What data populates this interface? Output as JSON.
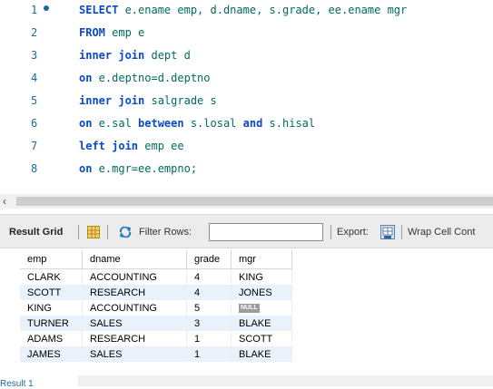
{
  "editor": {
    "lines": [
      {
        "num": "1",
        "marker": true,
        "tokens": [
          {
            "t": "SELECT",
            "k": "kw"
          },
          {
            "t": " e.ename emp, d.dname, s.grade, ee.ename mgr",
            "k": "tx"
          }
        ]
      },
      {
        "num": "2",
        "tokens": [
          {
            "t": "FROM",
            "k": "kw"
          },
          {
            "t": " emp e",
            "k": "tx"
          }
        ]
      },
      {
        "num": "3",
        "tokens": [
          {
            "t": "inner join",
            "k": "kw"
          },
          {
            "t": " dept d",
            "k": "tx"
          }
        ]
      },
      {
        "num": "4",
        "tokens": [
          {
            "t": "on",
            "k": "kw"
          },
          {
            "t": " e.deptno=d.deptno",
            "k": "tx"
          }
        ]
      },
      {
        "num": "5",
        "tokens": [
          {
            "t": "inner join",
            "k": "kw"
          },
          {
            "t": " salgrade s",
            "k": "tx"
          }
        ]
      },
      {
        "num": "6",
        "tokens": [
          {
            "t": "on",
            "k": "kw"
          },
          {
            "t": " e.sal ",
            "k": "tx"
          },
          {
            "t": "between",
            "k": "kw"
          },
          {
            "t": " s.losal ",
            "k": "tx"
          },
          {
            "t": "and",
            "k": "kw"
          },
          {
            "t": " s.hisal",
            "k": "tx"
          }
        ]
      },
      {
        "num": "7",
        "tokens": [
          {
            "t": "left join",
            "k": "kw"
          },
          {
            "t": " emp ee",
            "k": "tx"
          }
        ]
      },
      {
        "num": "8",
        "tokens": [
          {
            "t": "on",
            "k": "kw"
          },
          {
            "t": " e.mgr=ee.empno;",
            "k": "tx"
          }
        ]
      }
    ]
  },
  "scrollbar": {
    "arrow": "‹"
  },
  "toolbar": {
    "result_grid_label": "Result Grid",
    "filter_label": "Filter Rows:",
    "filter_value": "",
    "export_label": "Export:",
    "wrap_label": "Wrap Cell Cont"
  },
  "grid": {
    "columns": [
      "emp",
      "dname",
      "grade",
      "mgr"
    ],
    "rows": [
      [
        "CLARK",
        "ACCOUNTING",
        "4",
        "KING"
      ],
      [
        "SCOTT",
        "RESEARCH",
        "4",
        "JONES"
      ],
      [
        "KING",
        "ACCOUNTING",
        "5",
        "NULL"
      ],
      [
        "TURNER",
        "SALES",
        "3",
        "BLAKE"
      ],
      [
        "ADAMS",
        "RESEARCH",
        "1",
        "SCOTT"
      ],
      [
        "JAMES",
        "SALES",
        "1",
        "BLAKE"
      ]
    ],
    "null_label": "NULL"
  },
  "bottom_tab": "Result 1"
}
